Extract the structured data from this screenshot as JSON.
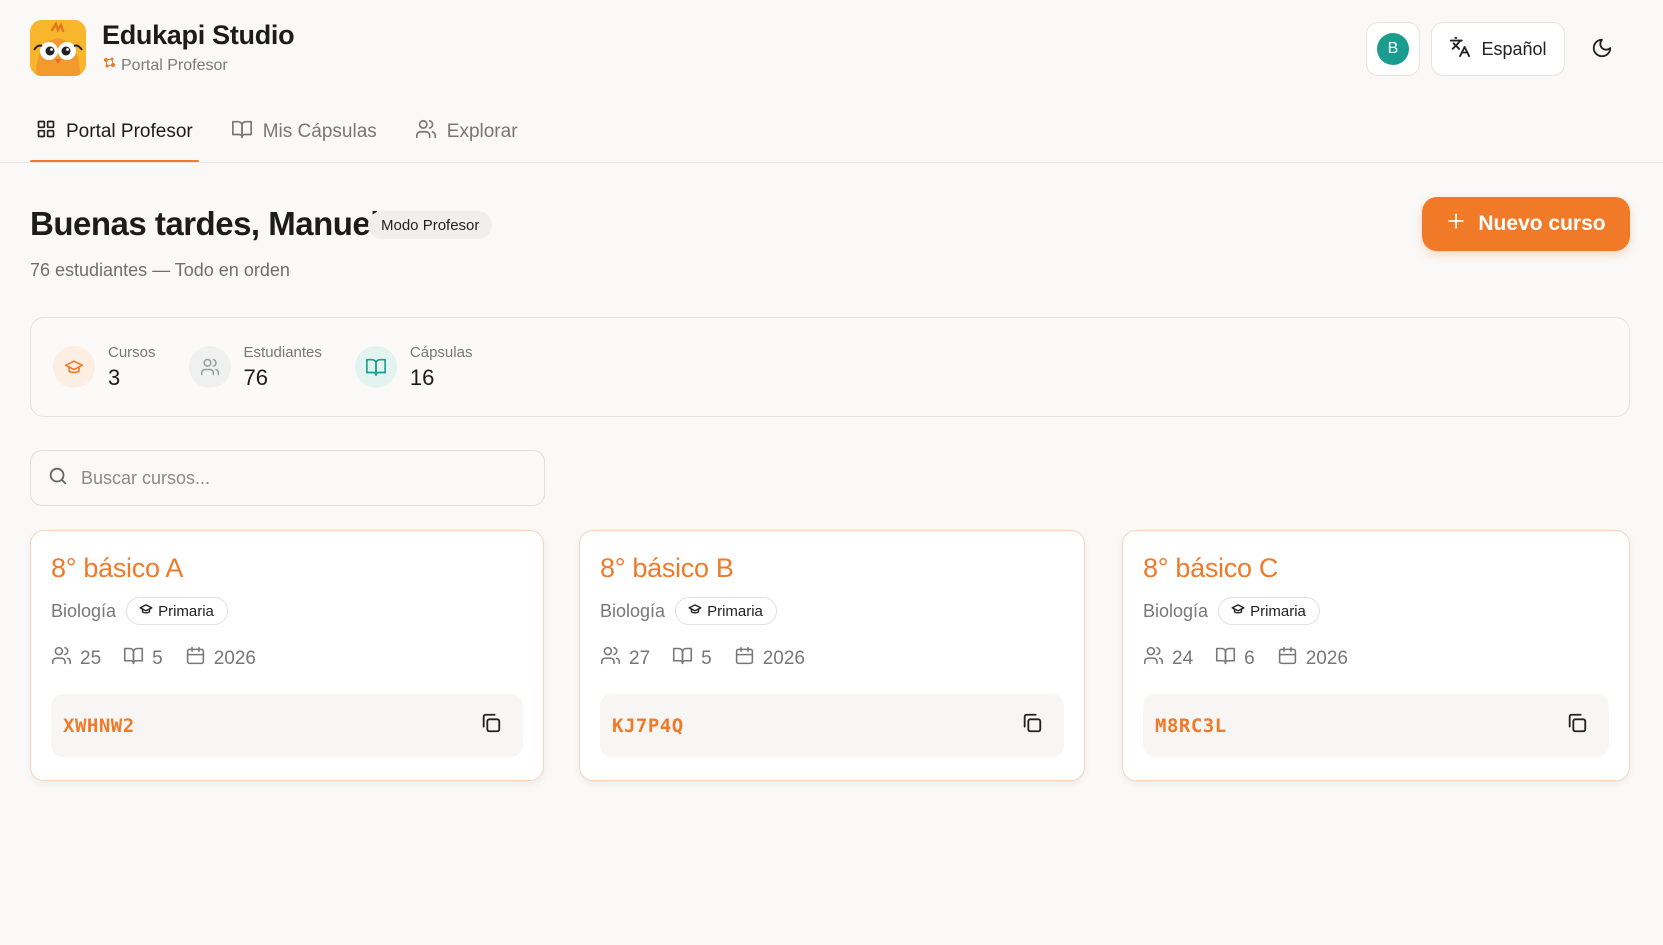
{
  "app": {
    "title": "Edukapi Studio",
    "subtitle": "Portal Profesor",
    "logo_icon": "owl-mascot-logo",
    "accent_color": "#f07a28"
  },
  "header": {
    "avatar_initial": "B",
    "avatar_color": "#1a9d8f",
    "language_label": "Español",
    "language_icon": "translate-icon",
    "theme_icon": "moon-icon"
  },
  "tabs": [
    {
      "label": "Portal Profesor",
      "icon": "grid-icon",
      "active": true
    },
    {
      "label": "Mis Cápsulas",
      "icon": "book-open-icon",
      "active": false
    },
    {
      "label": "Explorar",
      "icon": "users-icon",
      "active": false
    }
  ],
  "greeting": {
    "title": "Buenas tardes, Manuel",
    "mode_badge": "Modo Profesor",
    "status": "76 estudiantes — Todo en orden"
  },
  "new_course_button": {
    "label": "Nuevo curso",
    "icon": "plus-icon"
  },
  "stats": [
    {
      "label": "Cursos",
      "value": "3",
      "icon": "graduation-cap-icon",
      "color": "#f07a28",
      "bg": "#fdeee3"
    },
    {
      "label": "Estudiantes",
      "value": "76",
      "icon": "users-icon",
      "color": "#9aa6a4",
      "bg": "#eff1f0"
    },
    {
      "label": "Cápsulas",
      "value": "16",
      "icon": "book-open-icon",
      "color": "#1a9d8f",
      "bg": "#e3f3f0"
    }
  ],
  "search": {
    "placeholder": "Buscar cursos..."
  },
  "courses": [
    {
      "title": "8° básico A",
      "subject": "Biología",
      "level": "Primaria",
      "students": "25",
      "capsules": "5",
      "year": "2026",
      "code": "XWHNW2"
    },
    {
      "title": "8° básico B",
      "subject": "Biología",
      "level": "Primaria",
      "students": "27",
      "capsules": "5",
      "year": "2026",
      "code": "KJ7P4Q"
    },
    {
      "title": "8° básico C",
      "subject": "Biología",
      "level": "Primaria",
      "students": "24",
      "capsules": "6",
      "year": "2026",
      "code": "M8RC3L"
    }
  ]
}
